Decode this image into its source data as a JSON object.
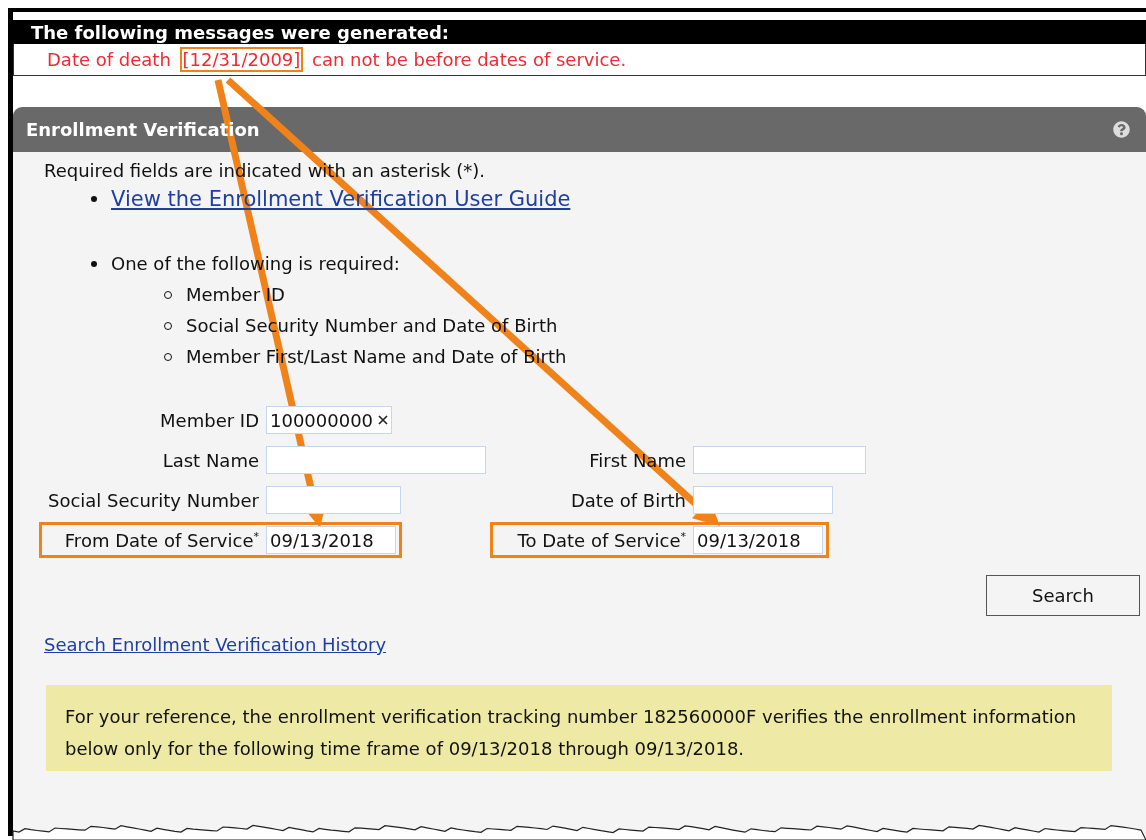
{
  "messages_panel": {
    "title": "The following messages were generated:",
    "messages": [
      {
        "parts": [
          {
            "text": "Date of death ",
            "highlighted": false
          },
          {
            "text": "[12/31/2009]",
            "highlighted": true
          },
          {
            "text": " can not be before dates of service.",
            "highlighted": false
          }
        ]
      }
    ]
  },
  "panel": {
    "title": "Enrollment Verification",
    "required_note": "Required fields are indicated with an asterisk (*).",
    "guide_link": "View the Enrollment Verification User Guide",
    "requirement": "One of the following is required:",
    "options": [
      "Member ID",
      "Social Security Number and Date of Birth",
      "Member First/Last Name and Date of Birth"
    ],
    "rows": [
      {
        "left": {
          "label": "Member ID",
          "value": "100000000",
          "clearable": true,
          "highlighted": false
        }
      },
      {
        "left": {
          "label": "Last Name",
          "highlighted": false
        },
        "right": {
          "label": "First Name",
          "highlighted": false
        }
      },
      {
        "left": {
          "label": "Social Security Number",
          "highlighted": false
        },
        "right": {
          "label": "Date of Birth",
          "highlighted": false
        }
      },
      {
        "left": {
          "label": "From Date of Service$^{*}$",
          "value": "09/13/2018",
          "highlighted": true
        },
        "right": {
          "label": "To Date of Service$^{*}$",
          "value": "09/13/2018",
          "highlighted": true
        }
      }
    ],
    "search_button": "Search",
    "history_link": "Search Enrollment Verification History",
    "reference_note": "For your reference, the enrollment verification tracking number 182560000F verifies the enrollment information below only for the following time frame of 09/13/2018 through 09/13/2018."
  }
}
